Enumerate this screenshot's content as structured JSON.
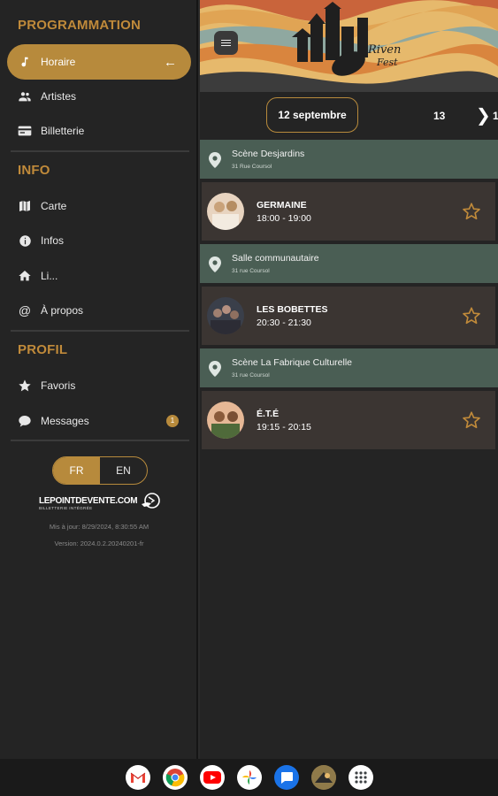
{
  "sidebar": {
    "sections": {
      "programmation": "PROGRAMMATION",
      "info": "INFO",
      "profil": "PROFIL"
    },
    "items": {
      "horaire": "Horaire",
      "artistes": "Artistes",
      "billetterie": "Billetterie",
      "carte": "Carte",
      "infos": "Infos",
      "liens": "Li...",
      "apropos": "À propos",
      "favoris": "Favoris",
      "messages": "Messages"
    },
    "messages_badge": "1",
    "lang": {
      "fr": "FR",
      "en": "EN"
    },
    "logo_main": "LEPOINTDEVENTE.COM",
    "logo_sub": "BILLETTERIE INTÉGRÉE",
    "updated": "Mis à jour: 8/29/2024, 8:30:55 AM",
    "version": "Version: 2024.0.2.20240201-fr"
  },
  "main": {
    "dates": {
      "selected": "12 septembre",
      "next": "13",
      "cut": "1"
    },
    "venues": [
      {
        "name": "Scène Desjardins",
        "address": "31 Rue Coursol"
      },
      {
        "name": "Salle communautaire",
        "address": "31 rue Coursol"
      },
      {
        "name": "Scène La Fabrique Culturelle",
        "address": "31 rue Coursol"
      }
    ],
    "performances": [
      {
        "name": "GERMAINE",
        "time": "18:00 - 19:00"
      },
      {
        "name": "LES BOBETTES",
        "time": "20:30 - 21:30"
      },
      {
        "name": "É.T.É",
        "time": "19:15 - 20:15"
      }
    ]
  },
  "colors": {
    "accent": "#b78a3c",
    "venue_bg": "#4a5e54",
    "card_bg": "#3b3532",
    "sidebar_bg": "#242424"
  },
  "taskbar": [
    "gmail-icon",
    "chrome-icon",
    "youtube-icon",
    "photos-icon",
    "messages-icon",
    "app-icon",
    "launcher-icon"
  ]
}
